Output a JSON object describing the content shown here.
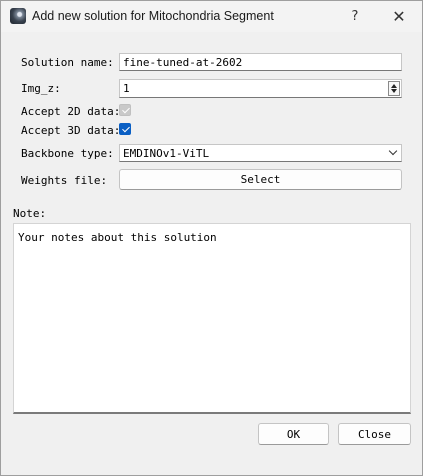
{
  "window": {
    "title": "Add new solution for Mitochondria Segment",
    "app_icon": "microscopy-app-icon",
    "help_glyph": "?",
    "close_glyph": "✕"
  },
  "form": {
    "solution_name": {
      "label": "Solution name:",
      "value": "fine-tuned-at-2602"
    },
    "img_z": {
      "label": "Img_z:",
      "value": "1"
    },
    "accept_2d": {
      "label": "Accept 2D data:",
      "checked": true,
      "enabled": false
    },
    "accept_3d": {
      "label": "Accept 3D data:",
      "checked": true,
      "enabled": true
    },
    "backbone": {
      "label": "Backbone type:",
      "value": "EMDINOv1-ViTL"
    },
    "weights": {
      "label": "Weights file:",
      "button_label": "Select"
    },
    "note": {
      "label": "Note:",
      "value": "Your notes about this solution"
    }
  },
  "buttons": {
    "ok": "OK",
    "close": "Close"
  },
  "colors": {
    "accent": "#0a5fc4",
    "disabled_check": "#c9c9c9",
    "background": "#f0f0f0"
  }
}
